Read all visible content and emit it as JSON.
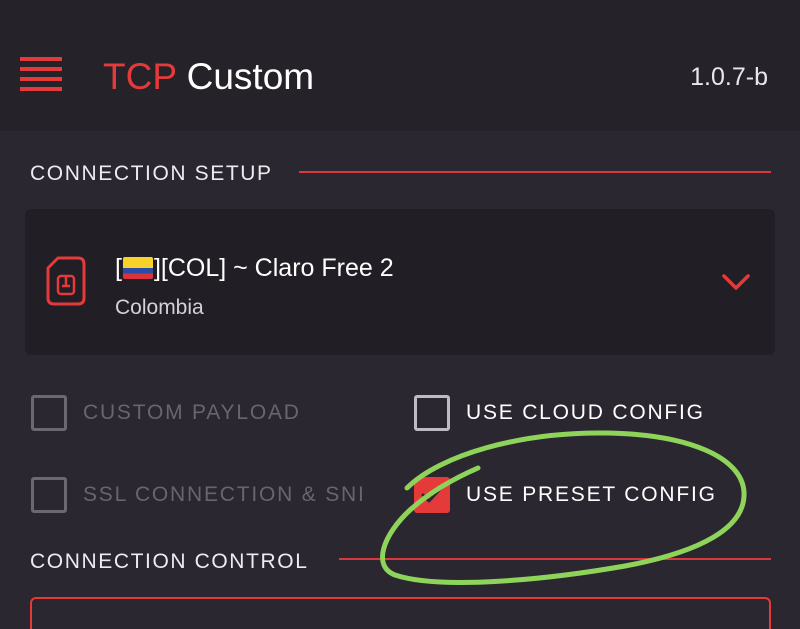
{
  "appbar": {
    "menu_icon": "hamburger-menu-icon",
    "title_accent": "TCP",
    "title_main": "Custom",
    "version": "1.0.7-b"
  },
  "connection_setup": {
    "label": "CONNECTION SETUP",
    "server": {
      "icon": "sim-card-icon",
      "name_prefix": "[",
      "flag": "colombia-flag-icon",
      "name_suffix": "][COL] ~ Claro Free 2",
      "country": "Colombia",
      "dropdown_icon": "chevron-down-icon"
    },
    "options": [
      {
        "label": "CUSTOM PAYLOAD",
        "checked": false,
        "enabled": false
      },
      {
        "label": "USE CLOUD CONFIG",
        "checked": false,
        "enabled": true
      },
      {
        "label": "SSL CONNECTION & SNI",
        "checked": false,
        "enabled": false
      },
      {
        "label": "USE PRESET CONFIG",
        "checked": true,
        "enabled": true
      }
    ]
  },
  "connection_control": {
    "label": "CONNECTION CONTROL"
  },
  "colors": {
    "accent": "#e53a3a",
    "background": "#2b2730",
    "appbar": "#252229",
    "card": "#211e25",
    "annotation": "#8fd45a"
  }
}
